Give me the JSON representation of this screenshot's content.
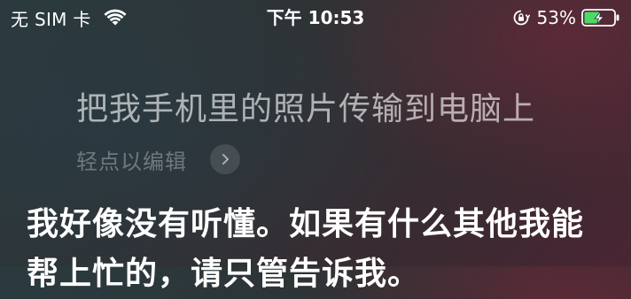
{
  "status_bar": {
    "carrier": "无 SIM 卡",
    "time": "下午 10:53",
    "battery_percent": "53%",
    "battery_level": 0.53,
    "charging": true,
    "icons": [
      "wifi-icon",
      "orientation-lock-icon",
      "battery-charging-icon"
    ]
  },
  "siri": {
    "query": "把我手机里的照片传输到电脑上",
    "edit_label": "轻点以编辑",
    "edit_icon": "chevron-right-icon",
    "response": "我好像没有听懂。如果有什么其他我能帮上忙的，请只管告诉我。"
  },
  "colors": {
    "battery_fill": "#4cd964",
    "text_primary": "#ffffff"
  }
}
